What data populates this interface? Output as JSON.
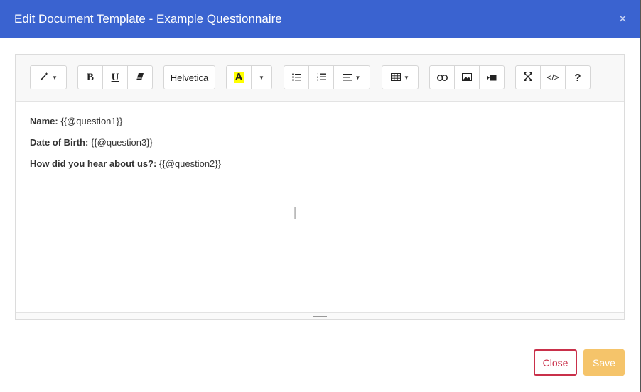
{
  "modal": {
    "title": "Edit Document Template - Example Questionnaire",
    "close_glyph": "×"
  },
  "toolbar": {
    "font_name": "Helvetica",
    "bold": "B",
    "underline": "U",
    "color_letter": "A",
    "highlight_color": "#ffff00",
    "code_view": "</>",
    "help": "?"
  },
  "content": {
    "lines": [
      {
        "label": "Name:",
        "value": "{{@question1}}"
      },
      {
        "label": "Date of Birth:",
        "value": "{{@question3}}"
      },
      {
        "label": "How did you hear about us?:",
        "value": "{{@question2}}"
      }
    ]
  },
  "footer": {
    "close_label": "Close",
    "save_label": "Save"
  },
  "colors": {
    "header": "#3a63d0",
    "close_border": "#c9304a",
    "save_bg": "#f5c46a"
  }
}
